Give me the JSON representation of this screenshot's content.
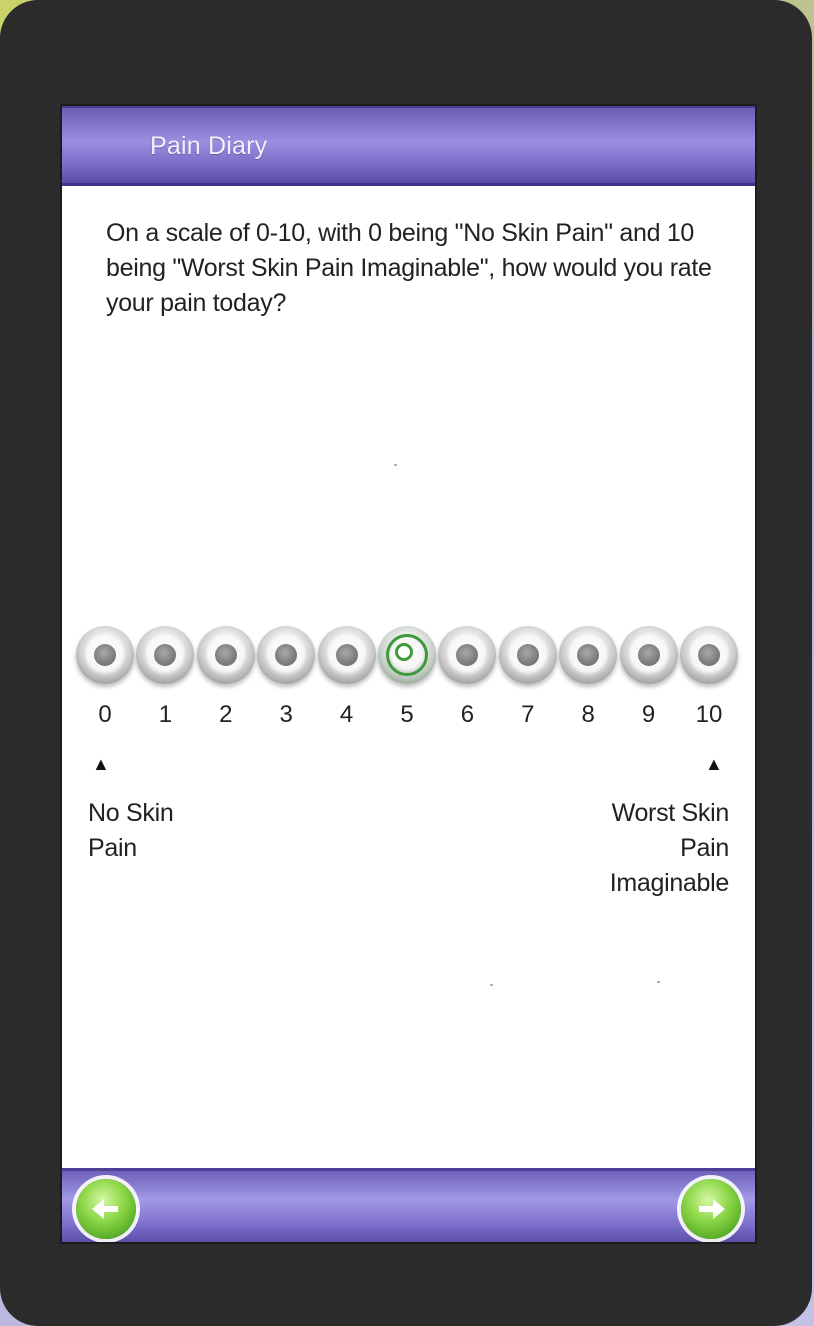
{
  "app": {
    "title": "Pain Diary"
  },
  "question": {
    "text": "On a scale of 0-10, with 0 being \"No Skin Pain\" and 10 being \"Worst Skin Pain Imaginable\", how would you rate your pain today?"
  },
  "scale": {
    "options": [
      "0",
      "1",
      "2",
      "3",
      "4",
      "5",
      "6",
      "7",
      "8",
      "9",
      "10"
    ],
    "selected": "5",
    "low_anchor": {
      "line1": "No Skin",
      "line2": "Pain"
    },
    "high_anchor": {
      "line1": "Worst Skin",
      "line2": "Pain",
      "line3": "Imaginable"
    },
    "low_arrow": "▲",
    "high_arrow": "▲"
  },
  "footer": {
    "back_icon": "arrow-left-icon",
    "next_icon": "arrow-right-icon"
  },
  "colors": {
    "header_purple": "#7a6cc8",
    "selected_green": "#3f9a3c",
    "nav_green": "#4aa21d"
  }
}
